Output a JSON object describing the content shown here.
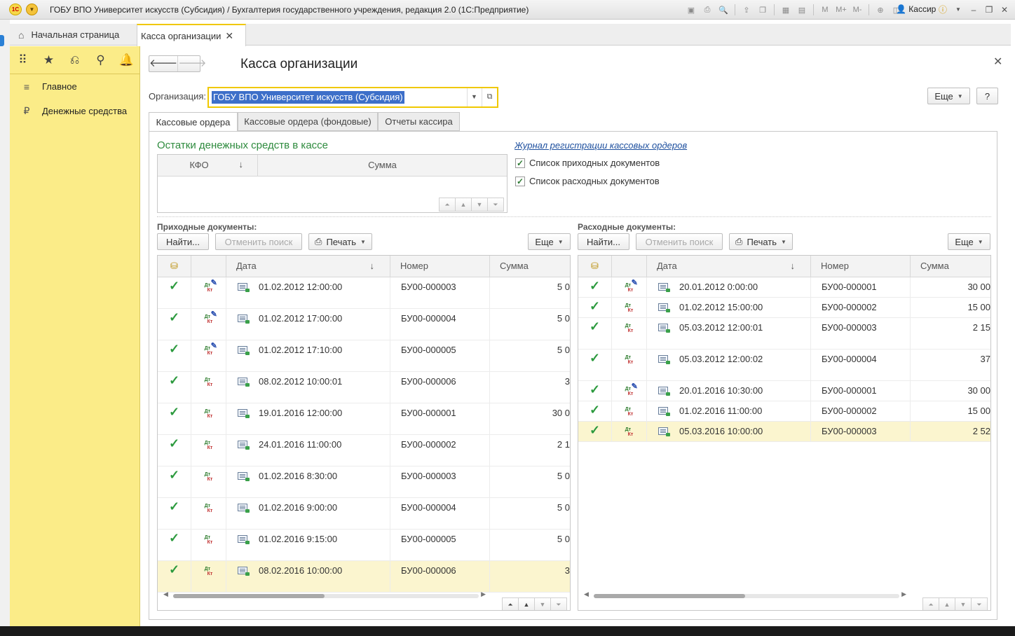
{
  "window": {
    "title": "ГОБУ ВПО Университет искусств (Субсидия) / Бухгалтерия государственного учреждения, редакция 2.0  (1С:Предприятие)",
    "user": "Кассир"
  },
  "tabs": {
    "home": "Начальная страница",
    "active": "Касса организации"
  },
  "sidebar": {
    "items": [
      {
        "label": "Главное",
        "icon": "menu-icon"
      },
      {
        "label": "Денежные средства",
        "icon": "ruble-coin-icon"
      }
    ]
  },
  "form": {
    "title": "Касса организации",
    "org_label": "Организация:",
    "org_value": "ГОБУ ВПО Университет искусств (Субсидия)",
    "more_label": "Еще",
    "help_label": "?",
    "inner_tabs": [
      "Кассовые ордера",
      "Кассовые ордера (фондовые)",
      "Отчеты кассира"
    ]
  },
  "balances": {
    "title": "Остатки денежных средств в кассе",
    "col_kfo": "КФО",
    "col_sum": "Сумма"
  },
  "links": {
    "journal": "Журнал регистрации кассовых ордеров",
    "cb_income": "Список приходных документов",
    "cb_expense": "Список расходных документов"
  },
  "income": {
    "title": "Приходные документы:",
    "find": "Найти...",
    "cancel_search": "Отменить поиск",
    "print": "Печать",
    "more": "Еще",
    "col_date": "Дата",
    "col_number": "Номер",
    "col_sum": "Сумма",
    "rows": [
      {
        "date": "01.02.2012 12:00:00",
        "number": "БУ00-000003",
        "sum": "5 0",
        "edit": true
      },
      {
        "date": "01.02.2012 17:00:00",
        "number": "БУ00-000004",
        "sum": "5 0",
        "edit": true
      },
      {
        "date": "01.02.2012 17:10:00",
        "number": "БУ00-000005",
        "sum": "5 0",
        "edit": true
      },
      {
        "date": "08.02.2012 10:00:01",
        "number": "БУ00-000006",
        "sum": "3",
        "edit": false
      },
      {
        "date": "19.01.2016 12:00:00",
        "number": "БУ00-000001",
        "sum": "30 0",
        "edit": false
      },
      {
        "date": "24.01.2016 11:00:00",
        "number": "БУ00-000002",
        "sum": "2 1",
        "edit": false
      },
      {
        "date": "01.02.2016 8:30:00",
        "number": "БУ00-000003",
        "sum": "5 0",
        "edit": false
      },
      {
        "date": "01.02.2016 9:00:00",
        "number": "БУ00-000004",
        "sum": "5 0",
        "edit": false
      },
      {
        "date": "01.02.2016 9:15:00",
        "number": "БУ00-000005",
        "sum": "5 0",
        "edit": false
      },
      {
        "date": "08.02.2016 10:00:00",
        "number": "БУ00-000006",
        "sum": "3",
        "edit": false
      }
    ]
  },
  "expense": {
    "title": "Расходные документы:",
    "find": "Найти...",
    "cancel_search": "Отменить поиск",
    "print": "Печать",
    "more": "Еще",
    "col_date": "Дата",
    "col_number": "Номер",
    "col_sum": "Сумма",
    "rows": [
      {
        "date": "20.01.2012 0:00:00",
        "number": "БУ00-000001",
        "sum": "30 00",
        "edit": true
      },
      {
        "date": "01.02.2012 15:00:00",
        "number": "БУ00-000002",
        "sum": "15 00",
        "edit": false
      },
      {
        "date": "05.03.2012 12:00:01",
        "number": "БУ00-000003",
        "sum": "2 15",
        "edit": false
      },
      {
        "date": "05.03.2012 12:00:02",
        "number": "БУ00-000004",
        "sum": "37",
        "edit": false
      },
      {
        "date": "20.01.2016 10:30:00",
        "number": "БУ00-000001",
        "sum": "30 00",
        "edit": true
      },
      {
        "date": "01.02.2016 11:00:00",
        "number": "БУ00-000002",
        "sum": "15 00",
        "edit": false
      },
      {
        "date": "05.03.2016 10:00:00",
        "number": "БУ00-000003",
        "sum": "2 52",
        "edit": false
      }
    ]
  },
  "colors": {
    "sidebar_bg": "#fbec88",
    "accent_yellow": "#f0c800",
    "section_green": "#2e8b3e",
    "link_blue": "#1d4f9e",
    "selected_row": "#fbf5cf"
  }
}
